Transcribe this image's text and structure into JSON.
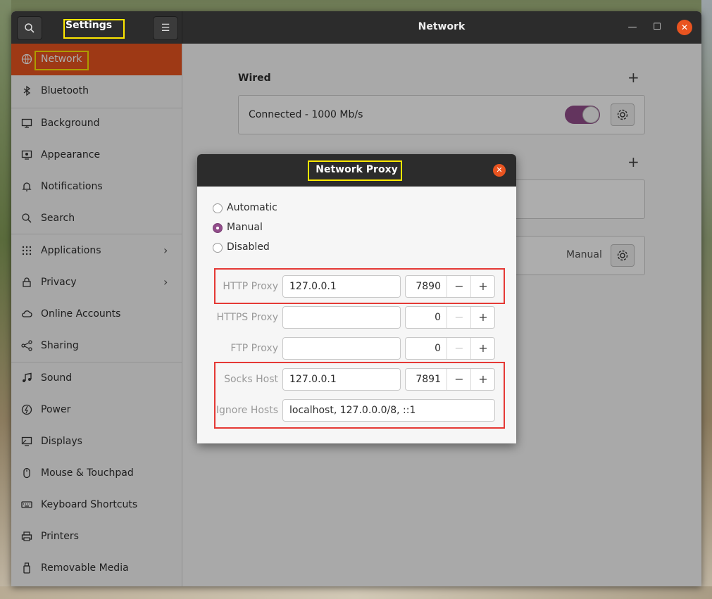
{
  "app": {
    "title": "Settings",
    "page_title": "Network"
  },
  "sidebar": {
    "items": [
      {
        "label": "Network",
        "icon": "globe-icon"
      },
      {
        "label": "Bluetooth",
        "icon": "bluetooth-icon"
      },
      {
        "label": "Background",
        "icon": "monitor-icon"
      },
      {
        "label": "Appearance",
        "icon": "appearance-icon"
      },
      {
        "label": "Notifications",
        "icon": "bell-icon"
      },
      {
        "label": "Search",
        "icon": "search-icon"
      },
      {
        "label": "Applications",
        "icon": "grid-icon"
      },
      {
        "label": "Privacy",
        "icon": "lock-icon"
      },
      {
        "label": "Online Accounts",
        "icon": "cloud-icon"
      },
      {
        "label": "Sharing",
        "icon": "share-icon"
      },
      {
        "label": "Sound",
        "icon": "music-icon"
      },
      {
        "label": "Power",
        "icon": "power-icon"
      },
      {
        "label": "Displays",
        "icon": "display-icon"
      },
      {
        "label": "Mouse & Touchpad",
        "icon": "mouse-icon"
      },
      {
        "label": "Keyboard Shortcuts",
        "icon": "keyboard-icon"
      },
      {
        "label": "Printers",
        "icon": "printer-icon"
      },
      {
        "label": "Removable Media",
        "icon": "usb-icon"
      }
    ]
  },
  "content": {
    "wired_title": "Wired",
    "connection_status": "Connected - 1000 Mb/s",
    "proxy_mode": "Manual"
  },
  "dialog": {
    "title": "Network Proxy",
    "modes": [
      "Automatic",
      "Manual",
      "Disabled"
    ],
    "selected_mode": "Manual",
    "http": {
      "label": "HTTP Proxy",
      "host": "127.0.0.1",
      "port": "7890"
    },
    "https": {
      "label": "HTTPS Proxy",
      "host": "",
      "port": "0"
    },
    "ftp": {
      "label": "FTP Proxy",
      "host": "",
      "port": "0"
    },
    "socks": {
      "label": "Socks Host",
      "host": "127.0.0.1",
      "port": "7891"
    },
    "ignore": {
      "label": "Ignore Hosts",
      "value": "localhost, 127.0.0.0/8, ::1"
    }
  },
  "colors": {
    "accent": "#e95420",
    "toggle": "#924d8b",
    "highlight_yellow": "#ffe800",
    "highlight_red": "#e53935"
  }
}
